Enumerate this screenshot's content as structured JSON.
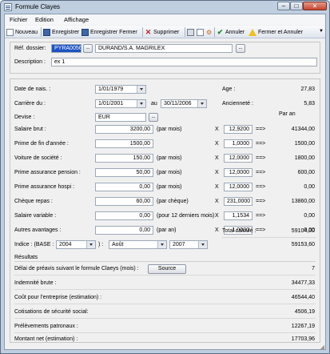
{
  "window": {
    "title": "Formule Clayes",
    "minimize": "–",
    "maximize": "□",
    "close": "×"
  },
  "menu": [
    "Fichier",
    "Edition",
    "Affichage"
  ],
  "toolbar": {
    "nouveau": "Nouveau",
    "enregistrer": "Enregistrer",
    "enregistrer_fermer": "Enregistrer Fermer",
    "supprimer": "Supprimer",
    "annuler": "Annuler",
    "fermer_annuler": "Fermer et Annuler",
    "more": "▼"
  },
  "header": {
    "ref_label": "Réf. dossier:",
    "ref_value": "PYRA0056",
    "browse": "...",
    "client_value": "DURAND/S.A. MAGRILEX",
    "desc_label": "Description :",
    "desc_value": "ex 1"
  },
  "dates": {
    "naissance_label": "Date de nais. :",
    "naissance_value": "1/01/1979",
    "carriere_label": "Carrière du :",
    "carriere_from": "1/01/2001",
    "au_label": "au",
    "carriere_to": "30/11/2006",
    "devise_label": "Devise :",
    "devise_value": "EUR",
    "age_label": "Age :",
    "age_value": "27,83",
    "anciennete_label": "Ancienneté :",
    "anciennete_value": "5,83",
    "par_an": "Par an"
  },
  "rows": [
    {
      "label": "Salaire brut :",
      "amount": "3200,00",
      "unit": "(par mois)",
      "x": "X",
      "factor": "12,9200",
      "arrow": "==>",
      "result": "41344,00"
    },
    {
      "label": "Prime de fin d'année :",
      "amount": "1500,00",
      "unit": "",
      "x": "X",
      "factor": "1,0000",
      "arrow": "==>",
      "result": "1500,00"
    },
    {
      "label": "Voiture de société :",
      "amount": "150,00",
      "unit": "(par mois)",
      "x": "X",
      "factor": "12,0000",
      "arrow": "==>",
      "result": "1800,00"
    },
    {
      "label": "Prime assurance pension :",
      "amount": "50,00",
      "unit": "(par mois)",
      "x": "X",
      "factor": "12,0000",
      "arrow": "==>",
      "result": "600,00"
    },
    {
      "label": "Prime assurance hospi :",
      "amount": "0,00",
      "unit": "(par mois)",
      "x": "X",
      "factor": "12,0000",
      "arrow": "==>",
      "result": "0,00"
    },
    {
      "label": "Chèque repas :",
      "amount": "60,00",
      "unit": "(par chèque)",
      "x": "X",
      "factor": "231,0000",
      "arrow": "==>",
      "result": "13860,00"
    },
    {
      "label": "Salaire variable :",
      "amount": "0,00",
      "unit": "(pour 12 derniers mois)",
      "x": "X",
      "factor": "1,1534",
      "arrow": "==>",
      "result": "0,00"
    },
    {
      "label": "Autres avantages :",
      "amount": "0,00",
      "unit": "(par an)",
      "x": "X",
      "factor": "1,0000",
      "arrow": "==>",
      "result": "0,00"
    }
  ],
  "total": {
    "label": "Total calculé :",
    "value": "59104,00"
  },
  "indice": {
    "label": "Indice : (BASE :",
    "base": "2004",
    "sep": ") :",
    "month": "Août",
    "year": "2007",
    "value": "59153,60"
  },
  "resultats": {
    "title": "Résultats",
    "preavis_label": "Délai de préavis suivant le formule Claeys (mois) :",
    "source_button": "Source",
    "preavis_value": "7",
    "indemnite_label": "Indemnité brute :",
    "indemnite_value": "34477,33",
    "cout_label": "Coût pour l'entreprise (estimation) :",
    "cout_value": "46544,40",
    "cotisations_label": "Cotisations de sécurité social:",
    "cotisations_value": "4506,19",
    "prelevements_label": "Prélèvements patronaux :",
    "prelevements_value": "12267,19",
    "montant_label": "Montant net (estimation) :",
    "montant_value": "17703,96"
  }
}
